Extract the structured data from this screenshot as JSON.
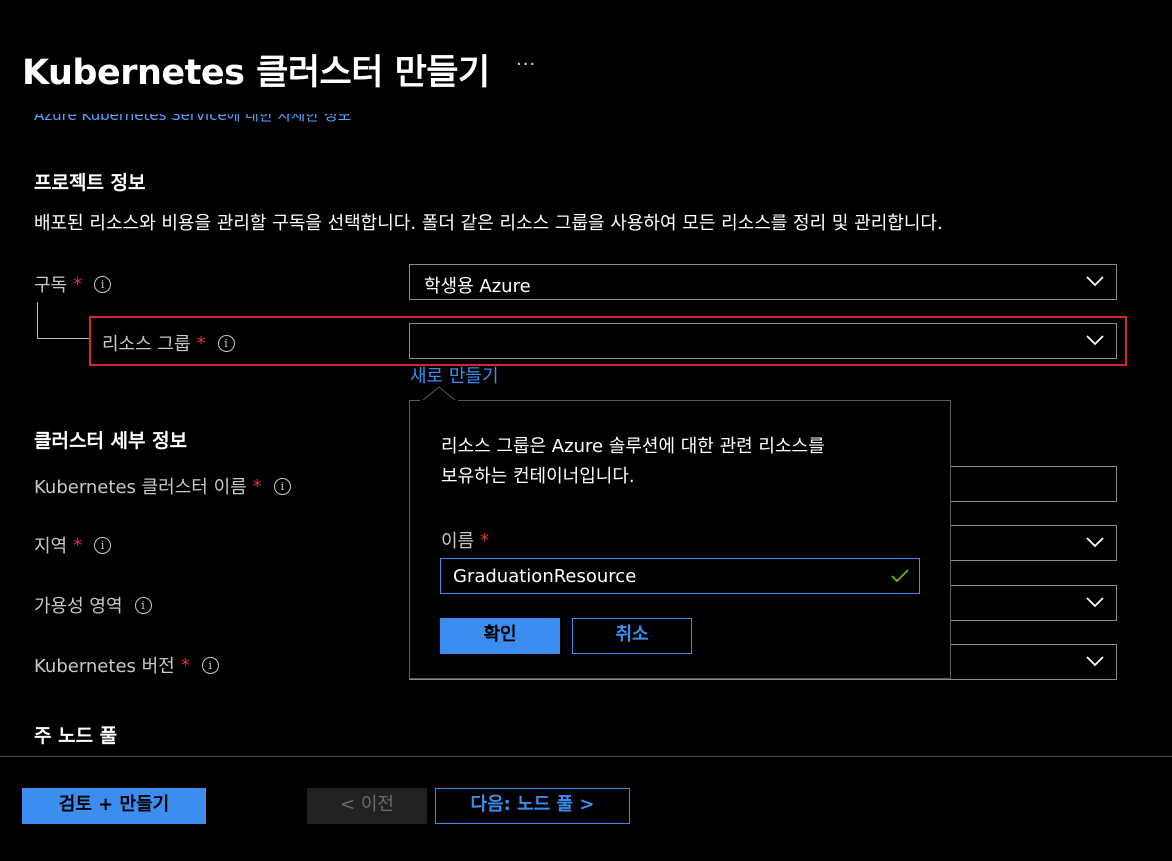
{
  "header": {
    "title": "Kubernetes 클러스터 만들기",
    "more": "···",
    "clipped_link": "Azure Kubernetes Service에 대한 자세한 정보"
  },
  "project": {
    "heading": "프로젝트 정보",
    "description": "배포된 리소스와 비용을 관리할 구독을 선택합니다. 폴더 같은 리소스 그룹을 사용하여 모든 리소스를 정리 및 관리합니다.",
    "subscription_label": "구독",
    "subscription_value": "학생용 Azure",
    "resource_group_label": "리소스 그룹",
    "resource_group_value": "",
    "create_new_link": "새로 만들기"
  },
  "cluster": {
    "heading": "클러스터 세부 정보",
    "name_label": "Kubernetes 클러스터 이름",
    "region_label": "지역",
    "zones_label": "가용성 영역",
    "version_label": "Kubernetes 버전"
  },
  "node_pool": {
    "heading": "주 노드 풀"
  },
  "popup": {
    "description_line1": "리소스 그룹은 Azure 솔루션에 대한 관련 리소스를",
    "description_line2": "보유하는 컨테이너입니다.",
    "name_label": "이름",
    "name_value": "GraduationResource",
    "ok_button": "확인",
    "cancel_button": "취소"
  },
  "footer": {
    "review_create": "검토 + 만들기",
    "previous": "< 이전",
    "next": "다음: 노드 풀 >"
  },
  "required_mark": "*",
  "info_glyph": "i",
  "colors": {
    "accent": "#3b8ef0",
    "required": "#e0343c",
    "highlight": "#d6262e",
    "valid_check": "#6bb700"
  }
}
